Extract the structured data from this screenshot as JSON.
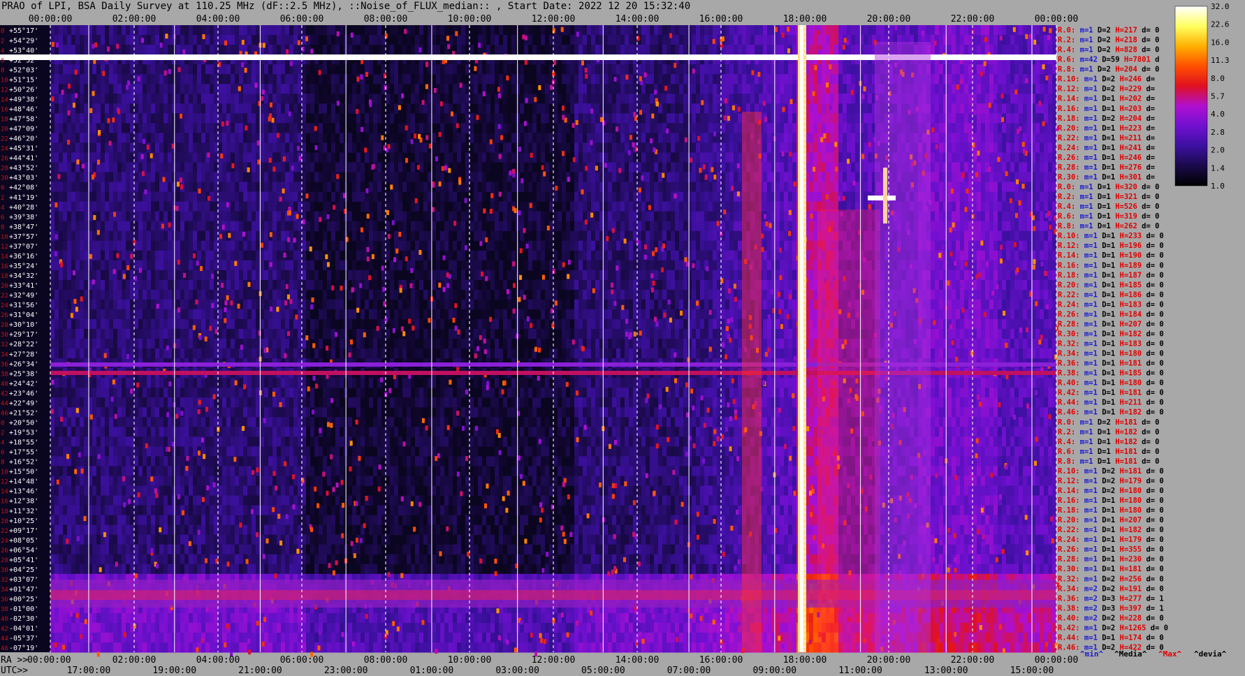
{
  "title": "PRAO of LPI, BSA Daily Survey at 110.25 MHz (dF::2.5 MHz), ::Noise_of_FLUX_median:: , Start Date: 2022 12 20 15:32:40",
  "chart_data": {
    "type": "heatmap",
    "title": "PRAO of LPI, BSA Daily Survey at 110.25 MHz (dF::2.5 MHz), ::Noise_of_FLUX_median:: , Start Date: 2022 12 20 15:32:40",
    "x_top_ticks": [
      "00:00:00",
      "02:00:00",
      "04:00:00",
      "06:00:00",
      "08:00:00",
      "10:00:00",
      "12:00:00",
      "14:00:00",
      "16:00:00",
      "18:00:00",
      "20:00:00",
      "22:00:00",
      "00:00:00"
    ],
    "x_bottom_ra_prefix": "RA >>",
    "x_bottom_ra_ticks": [
      "00:00:00",
      "02:00:00",
      "04:00:00",
      "06:00:00",
      "08:00:00",
      "10:00:00",
      "12:00:00",
      "14:00:00",
      "16:00:00",
      "18:00:00",
      "20:00:00",
      "22:00:00",
      "00:00:00"
    ],
    "x_bottom_utc_prefix": "UTC>>",
    "x_bottom_utc_ticks": [
      "17:00:00",
      "19:00:00",
      "21:00:00",
      "23:00:00",
      "01:00:00",
      "03:00:00",
      "05:00:00",
      "07:00:00",
      "09:00:00",
      "11:00:00",
      "13:00:00",
      "15:00:00"
    ],
    "y_ticks": [
      "+55°17'",
      "+54°29'",
      "+53°40'",
      "+52°52'",
      "+52°03'",
      "+51°15'",
      "+50°26'",
      "+49°38'",
      "+48°46'",
      "+47°58'",
      "+47°09'",
      "+46°20'",
      "+45°31'",
      "+44°41'",
      "+43°52'",
      "+43°03'",
      "+42°08'",
      "+41°19'",
      "+40°28'",
      "+39°38'",
      "+38°47'",
      "+37°57'",
      "+37°07'",
      "+36°16'",
      "+35°24'",
      "+34°32'",
      "+33°41'",
      "+32°49'",
      "+31°56'",
      "+31°04'",
      "+30°10'",
      "+29°17'",
      "+28°22'",
      "+27°28'",
      "+26°34'",
      "+25°38'",
      "+24°42'",
      "+23°46'",
      "+22°49'",
      "+21°52'",
      "+20°50'",
      "+19°53'",
      "+18°55'",
      "+17°55'",
      "+16°52'",
      "+15°50'",
      "+14°48'",
      "+13°46'",
      "+12°38'",
      "+11°32'",
      "+10°25'",
      "+09°17'",
      "+08°05'",
      "+06°54'",
      "+05°41'",
      "+04°25'",
      "+03°07'",
      "+01°47'",
      "+00°25'",
      "-01°00'",
      "-02°30'",
      "-04°01'",
      "-05°37'",
      "-07°19'"
    ],
    "y_index": [
      "0",
      "2",
      "4",
      "6",
      "8",
      "10",
      "12",
      "14",
      "16",
      "18",
      "20",
      "22",
      "24",
      "26",
      "28",
      "30",
      "0",
      "2",
      "4",
      "6",
      "8",
      "10",
      "12",
      "14",
      "16",
      "18",
      "20",
      "22",
      "24",
      "26",
      "28",
      "30",
      "32",
      "34",
      "36",
      "38",
      "40",
      "42",
      "44",
      "46",
      "0",
      "2",
      "4",
      "6",
      "8",
      "10",
      "12",
      "14",
      "16",
      "18",
      "20",
      "22",
      "24",
      "26",
      "28",
      "30",
      "32",
      "34",
      "36",
      "38",
      "40",
      "42",
      "44",
      "46"
    ],
    "right_rows": [
      {
        "r": "R.0:",
        "m": "m=1",
        "d": "D=2",
        "h": "H=217",
        "dv": "d= 0"
      },
      {
        "r": "R.2:",
        "m": "m=1",
        "d": "D=2",
        "h": "H=218",
        "dv": "d= 0"
      },
      {
        "r": "R.4:",
        "m": "m=1",
        "d": "D=2",
        "h": "H=828",
        "dv": "d= 0"
      },
      {
        "r": "R.6:",
        "m": "m=42",
        "d": "D=59",
        "h": "H=7801",
        "dv": "d"
      },
      {
        "r": "R.8:",
        "m": "m=1",
        "d": "D=2",
        "h": "H=204",
        "dv": "d= 0"
      },
      {
        "r": "R.10:",
        "m": "m=1",
        "d": "D=2",
        "h": "H=246",
        "dv": "d="
      },
      {
        "r": "R.12:",
        "m": "m=1",
        "d": "D=2",
        "h": "H=229",
        "dv": "d="
      },
      {
        "r": "R.14:",
        "m": "m=1",
        "d": "D=1",
        "h": "H=202",
        "dv": "d="
      },
      {
        "r": "R.16:",
        "m": "m=1",
        "d": "D=1",
        "h": "H=203",
        "dv": "d="
      },
      {
        "r": "R.18:",
        "m": "m=1",
        "d": "D=2",
        "h": "H=204",
        "dv": "d="
      },
      {
        "r": "R.20:",
        "m": "m=1",
        "d": "D=1",
        "h": "H=223",
        "dv": "d="
      },
      {
        "r": "R.22:",
        "m": "m=1",
        "d": "D=1",
        "h": "H=211",
        "dv": "d="
      },
      {
        "r": "R.24:",
        "m": "m=1",
        "d": "D=1",
        "h": "H=241",
        "dv": "d="
      },
      {
        "r": "R.26:",
        "m": "m=1",
        "d": "D=1",
        "h": "H=246",
        "dv": "d="
      },
      {
        "r": "R.28:",
        "m": "m=1",
        "d": "D=1",
        "h": "H=276",
        "dv": "d="
      },
      {
        "r": "R.30:",
        "m": "m=1",
        "d": "D=1",
        "h": "H=301",
        "dv": "d="
      },
      {
        "r": "R.0:",
        "m": "m=1",
        "d": "D=1",
        "h": "H=320",
        "dv": "d= 0"
      },
      {
        "r": "R.2:",
        "m": "m=1",
        "d": "D=1",
        "h": "H=321",
        "dv": "d= 0"
      },
      {
        "r": "R.4:",
        "m": "m=1",
        "d": "D=1",
        "h": "H=526",
        "dv": "d= 0"
      },
      {
        "r": "R.6:",
        "m": "m=1",
        "d": "D=1",
        "h": "H=319",
        "dv": "d= 0"
      },
      {
        "r": "R.8:",
        "m": "m=1",
        "d": "D=1",
        "h": "H=262",
        "dv": "d= 0"
      },
      {
        "r": "R.10:",
        "m": "m=1",
        "d": "D=1",
        "h": "H=233",
        "dv": "d= 0"
      },
      {
        "r": "R.12:",
        "m": "m=1",
        "d": "D=1",
        "h": "H=196",
        "dv": "d= 0"
      },
      {
        "r": "R.14:",
        "m": "m=1",
        "d": "D=1",
        "h": "H=190",
        "dv": "d= 0"
      },
      {
        "r": "R.16:",
        "m": "m=1",
        "d": "D=1",
        "h": "H=189",
        "dv": "d= 0"
      },
      {
        "r": "R.18:",
        "m": "m=1",
        "d": "D=1",
        "h": "H=187",
        "dv": "d= 0"
      },
      {
        "r": "R.20:",
        "m": "m=1",
        "d": "D=1",
        "h": "H=185",
        "dv": "d= 0"
      },
      {
        "r": "R.22:",
        "m": "m=1",
        "d": "D=1",
        "h": "H=186",
        "dv": "d= 0"
      },
      {
        "r": "R.24:",
        "m": "m=1",
        "d": "D=1",
        "h": "H=183",
        "dv": "d= 0"
      },
      {
        "r": "R.26:",
        "m": "m=1",
        "d": "D=1",
        "h": "H=184",
        "dv": "d= 0"
      },
      {
        "r": "R.28:",
        "m": "m=1",
        "d": "D=1",
        "h": "H=207",
        "dv": "d= 0"
      },
      {
        "r": "R.30:",
        "m": "m=1",
        "d": "D=1",
        "h": "H=182",
        "dv": "d= 0"
      },
      {
        "r": "R.32:",
        "m": "m=1",
        "d": "D=1",
        "h": "H=183",
        "dv": "d= 0"
      },
      {
        "r": "R.34:",
        "m": "m=1",
        "d": "D=1",
        "h": "H=180",
        "dv": "d= 0"
      },
      {
        "r": "R.36:",
        "m": "m=1",
        "d": "D=1",
        "h": "H=181",
        "dv": "d= 0"
      },
      {
        "r": "R.38:",
        "m": "m=1",
        "d": "D=1",
        "h": "H=185",
        "dv": "d= 0"
      },
      {
        "r": "R.40:",
        "m": "m=1",
        "d": "D=1",
        "h": "H=180",
        "dv": "d= 0"
      },
      {
        "r": "R.42:",
        "m": "m=1",
        "d": "D=1",
        "h": "H=181",
        "dv": "d= 0"
      },
      {
        "r": "R.44:",
        "m": "m=1",
        "d": "D=1",
        "h": "H=211",
        "dv": "d= 0"
      },
      {
        "r": "R.46:",
        "m": "m=1",
        "d": "D=1",
        "h": "H=182",
        "dv": "d= 0"
      },
      {
        "r": "R.0:",
        "m": "m=1",
        "d": "D=2",
        "h": "H=181",
        "dv": "d= 0"
      },
      {
        "r": "R.2:",
        "m": "m=1",
        "d": "D=1",
        "h": "H=182",
        "dv": "d= 0"
      },
      {
        "r": "R.4:",
        "m": "m=1",
        "d": "D=1",
        "h": "H=182",
        "dv": "d= 0"
      },
      {
        "r": "R.6:",
        "m": "m=1",
        "d": "D=1",
        "h": "H=181",
        "dv": "d= 0"
      },
      {
        "r": "R.8:",
        "m": "m=1",
        "d": "D=1",
        "h": "H=181",
        "dv": "d= 0"
      },
      {
        "r": "R.10:",
        "m": "m=1",
        "d": "D=2",
        "h": "H=181",
        "dv": "d= 0"
      },
      {
        "r": "R.12:",
        "m": "m=1",
        "d": "D=2",
        "h": "H=179",
        "dv": "d= 0"
      },
      {
        "r": "R.14:",
        "m": "m=1",
        "d": "D=2",
        "h": "H=180",
        "dv": "d= 0"
      },
      {
        "r": "R.16:",
        "m": "m=1",
        "d": "D=1",
        "h": "H=180",
        "dv": "d= 0"
      },
      {
        "r": "R.18:",
        "m": "m=1",
        "d": "D=1",
        "h": "H=180",
        "dv": "d= 0"
      },
      {
        "r": "R.20:",
        "m": "m=1",
        "d": "D=1",
        "h": "H=207",
        "dv": "d= 0"
      },
      {
        "r": "R.22:",
        "m": "m=1",
        "d": "D=1",
        "h": "H=182",
        "dv": "d= 0"
      },
      {
        "r": "R.24:",
        "m": "m=1",
        "d": "D=1",
        "h": "H=179",
        "dv": "d= 0"
      },
      {
        "r": "R.26:",
        "m": "m=1",
        "d": "D=1",
        "h": "H=355",
        "dv": "d= 0"
      },
      {
        "r": "R.28:",
        "m": "m=1",
        "d": "D=1",
        "h": "H=230",
        "dv": "d= 0"
      },
      {
        "r": "R.30:",
        "m": "m=1",
        "d": "D=1",
        "h": "H=181",
        "dv": "d= 0"
      },
      {
        "r": "R.32:",
        "m": "m=1",
        "d": "D=2",
        "h": "H=256",
        "dv": "d= 0"
      },
      {
        "r": "R.34:",
        "m": "m=2",
        "d": "D=2",
        "h": "H=191",
        "dv": "d= 0"
      },
      {
        "r": "R.36:",
        "m": "m=2",
        "d": "D=3",
        "h": "H=277",
        "dv": "d= 1"
      },
      {
        "r": "R.38:",
        "m": "m=2",
        "d": "D=3",
        "h": "H=397",
        "dv": "d= 1"
      },
      {
        "r": "R.40:",
        "m": "m=2",
        "d": "D=2",
        "h": "H=228",
        "dv": "d= 0"
      },
      {
        "r": "R.42:",
        "m": "m=1",
        "d": "D=2",
        "h": "H=1265",
        "dv": "d= 0"
      },
      {
        "r": "R.44:",
        "m": "m=1",
        "d": "D=1",
        "h": "H=174",
        "dv": "d= 0"
      },
      {
        "r": "R.46:",
        "m": "m=1",
        "d": "D=2",
        "h": "H=422",
        "dv": "d= 0"
      }
    ],
    "footer_legend": [
      "^min^",
      "^Media^",
      "^Max^",
      "^devia^"
    ],
    "colorbar_ticks": [
      "32.0",
      "22.6",
      "16.0",
      "11.3",
      "8.0",
      "5.7",
      "4.0",
      "2.8",
      "2.0",
      "1.4",
      "1.0"
    ],
    "colorscale": [
      "#000000",
      "#1a0a4a",
      "#3c10a0",
      "#7010d0",
      "#b010d0",
      "#e01020",
      "#ff5000",
      "#ffb000",
      "#ffff60",
      "#ffffff"
    ],
    "colors": {
      "background": "#a8a8a8",
      "grid": "#ffffff",
      "label_index": "#d01010",
      "label_dec": "#ffffff",
      "row_red": "#e00000",
      "row_blue": "#1a1ad0"
    }
  }
}
